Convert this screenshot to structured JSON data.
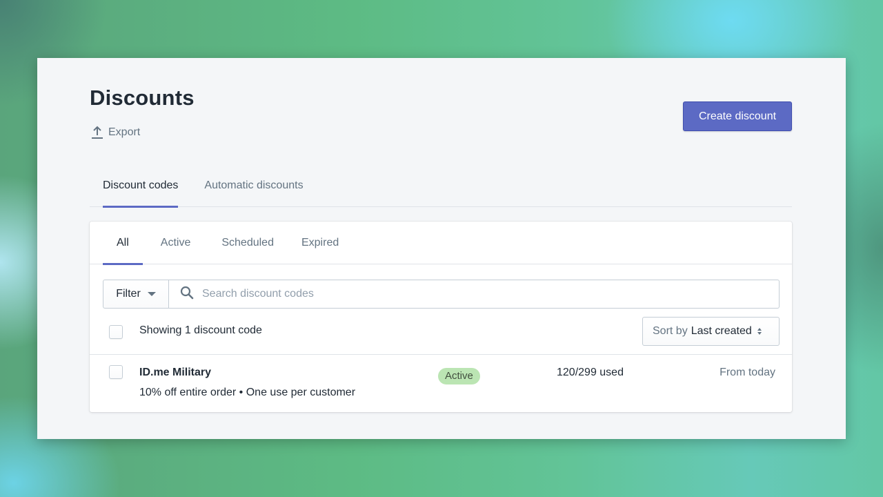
{
  "page": {
    "title": "Discounts",
    "export_label": "Export",
    "create_button_label": "Create discount",
    "accent_color": "#5c6ac4"
  },
  "top_tabs": [
    {
      "label": "Discount codes",
      "active": true
    },
    {
      "label": "Automatic discounts",
      "active": false
    }
  ],
  "sub_tabs": [
    {
      "label": "All",
      "active": true
    },
    {
      "label": "Active",
      "active": false
    },
    {
      "label": "Scheduled",
      "active": false
    },
    {
      "label": "Expired",
      "active": false
    }
  ],
  "filter": {
    "button_label": "Filter",
    "search_placeholder": "Search discount codes",
    "search_value": ""
  },
  "list": {
    "showing_text": "Showing 1 discount code",
    "sort_label": "Sort by",
    "sort_value": "Last created",
    "rows": [
      {
        "title": "ID.me Military",
        "description": "10% off entire order • One use per customer",
        "status": "Active",
        "status_color": "#bbe5b3",
        "usage": "120/299 used",
        "date": "From today",
        "checked": false
      }
    ]
  }
}
